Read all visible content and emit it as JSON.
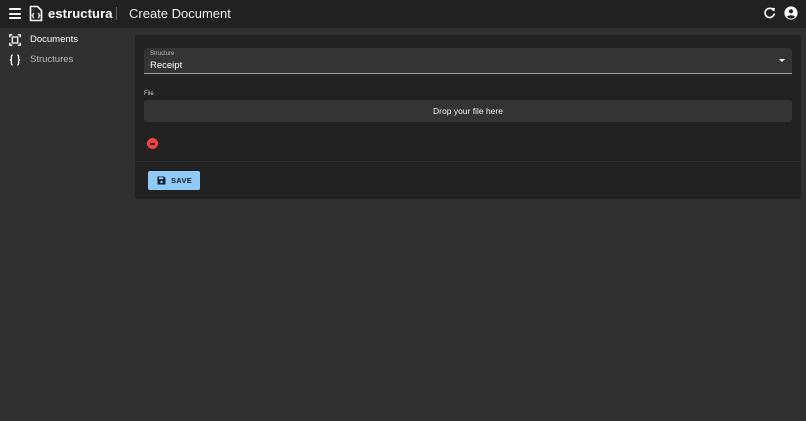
{
  "app": {
    "brand": "estructura",
    "page_title": "Create Document",
    "icons": {
      "menu": "menu-icon",
      "logo": "code-file-icon",
      "refresh": "refresh-icon",
      "account": "account-circle-icon"
    }
  },
  "sidebar": {
    "items": [
      {
        "label": "Documents",
        "icon": "document-scanner-icon",
        "active": true
      },
      {
        "label": "Structures",
        "icon": "curly-braces-icon",
        "active": false
      }
    ]
  },
  "form": {
    "structure_label": "Structure",
    "structure_value": "Receipt",
    "file_label": "File",
    "dropzone_text": "Drop your file here",
    "save_label": "SAVE"
  },
  "colors": {
    "appbar": "#212121",
    "background": "#303030",
    "card": "#222222",
    "field": "#343434",
    "primary": "#90caf9",
    "danger": "#f44336"
  }
}
